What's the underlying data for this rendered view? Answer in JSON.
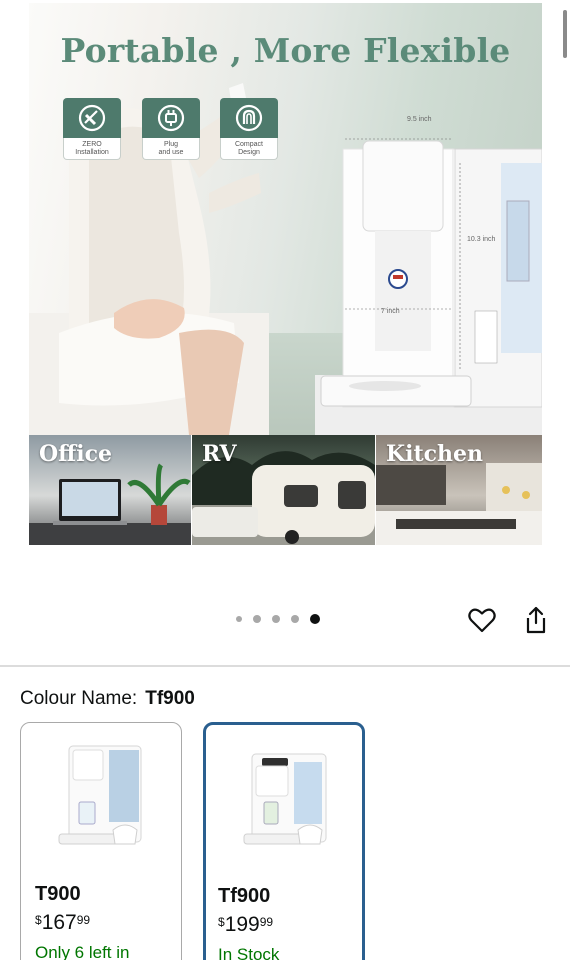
{
  "hero": {
    "headline": "Portable , More Flexible",
    "badges": [
      {
        "icon": "no-tool-icon",
        "caption": "ZERO\nInstallation"
      },
      {
        "icon": "plug-icon",
        "caption": "Plug\nand use"
      },
      {
        "icon": "compact-design-icon",
        "caption": "Compact\nDesign"
      }
    ],
    "dimensions": {
      "width": "9.5 inch",
      "height": "10.3 inch",
      "depth": "7 inch"
    },
    "scenes": [
      "Office",
      "RV",
      "Kitchen"
    ]
  },
  "carousel": {
    "total": 5,
    "active_index": 4
  },
  "actions": {
    "favorite_icon": "heart-icon",
    "share_icon": "share-icon"
  },
  "colour": {
    "label": "Colour Name:",
    "value": "Tf900"
  },
  "variants": [
    {
      "name": "T900",
      "currency": "$",
      "price_whole": "167",
      "price_cents": "99",
      "stock": "Only 6 left in",
      "selected": false
    },
    {
      "name": "Tf900",
      "currency": "$",
      "price_whole": "199",
      "price_cents": "99",
      "stock": "In Stock",
      "selected": true
    }
  ],
  "colors": {
    "stock_green": "#007600",
    "selected_border": "#2a5f8f",
    "headline_green": "#5b8b79"
  }
}
